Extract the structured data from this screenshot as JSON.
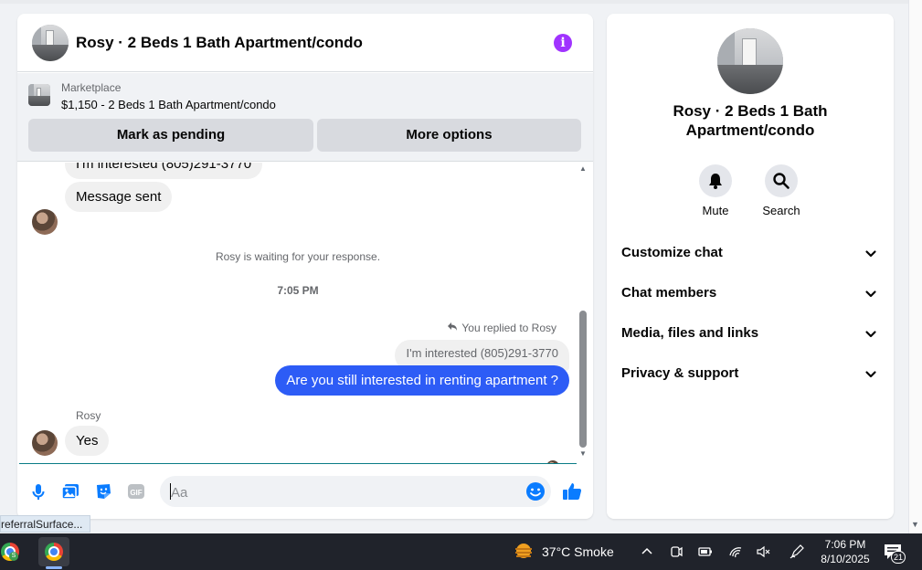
{
  "chat": {
    "title": "Rosy · 2 Beds 1 Bath Apartment/condo",
    "marketplace_label": "Marketplace",
    "listing": "$1,150 - 2 Beds 1 Bath Apartment/condo",
    "mark_pending_label": "Mark as pending",
    "more_options_label": "More options"
  },
  "messages": {
    "clipped_text": "I'm interested (805)291-3770",
    "sent_text": "Message sent",
    "waiting_text": "Rosy is waiting for your response.",
    "timestamp": "7:05 PM",
    "replied_to": "You replied to Rosy",
    "quoted_text": "I'm interested (805)291-3770",
    "outgoing_text": "Are you still interested in renting apartment ?",
    "sender_name": "Rosy",
    "reply_text": "Yes"
  },
  "composer": {
    "placeholder": "Aa",
    "icons": [
      "mic-icon",
      "photo-icon",
      "sticker-icon",
      "gif-icon",
      "emoji-icon",
      "like-icon"
    ],
    "gif_label": "GIF"
  },
  "details": {
    "title": "Rosy · 2 Beds 1 Bath Apartment/condo",
    "mute_label": "Mute",
    "search_label": "Search",
    "sections": [
      {
        "label": "Customize chat"
      },
      {
        "label": "Chat members"
      },
      {
        "label": "Media, files and links"
      },
      {
        "label": "Privacy & support"
      }
    ]
  },
  "status_url": "referralSurface...",
  "taskbar": {
    "weather": "37°C  Smoke",
    "time": "7:06 PM",
    "date": "8/10/2025",
    "notification_count": "21",
    "chrome_badge": "S"
  },
  "colors": {
    "accent_blue": "#2d5cf6",
    "info_purple": "#a033ff",
    "like_blue": "#0a7cff"
  }
}
